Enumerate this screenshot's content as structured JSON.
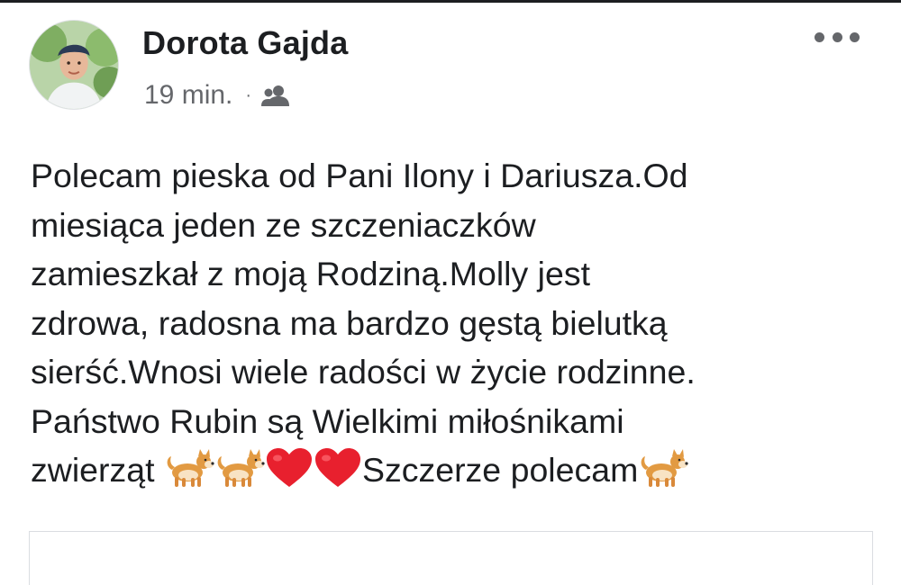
{
  "post": {
    "author": "Dorota Gajda",
    "time": "19 min.",
    "separator": "·",
    "audience_icon": "friends-icon",
    "more_icon": "more-options-icon",
    "text_lines": [
      "Polecam pieska od Pani Ilony i Dariusza.Od",
      "miesiąca jeden ze szczeniaczków",
      "zamieszkał z moją Rodziną.Molly jest",
      "zdrowa, radosna ma bardzo gęstą bielutką",
      "sierść.Wnosi wiele radości w życie rodzinne.",
      "Państwo Rubin są Wielkimi miłośnikami",
      "zwierząt "
    ],
    "last_line_text": "Szczerze polecam",
    "emojis": [
      "dog-emoji",
      "dog-emoji",
      "red-heart-emoji",
      "red-heart-emoji",
      "dog-emoji"
    ]
  }
}
